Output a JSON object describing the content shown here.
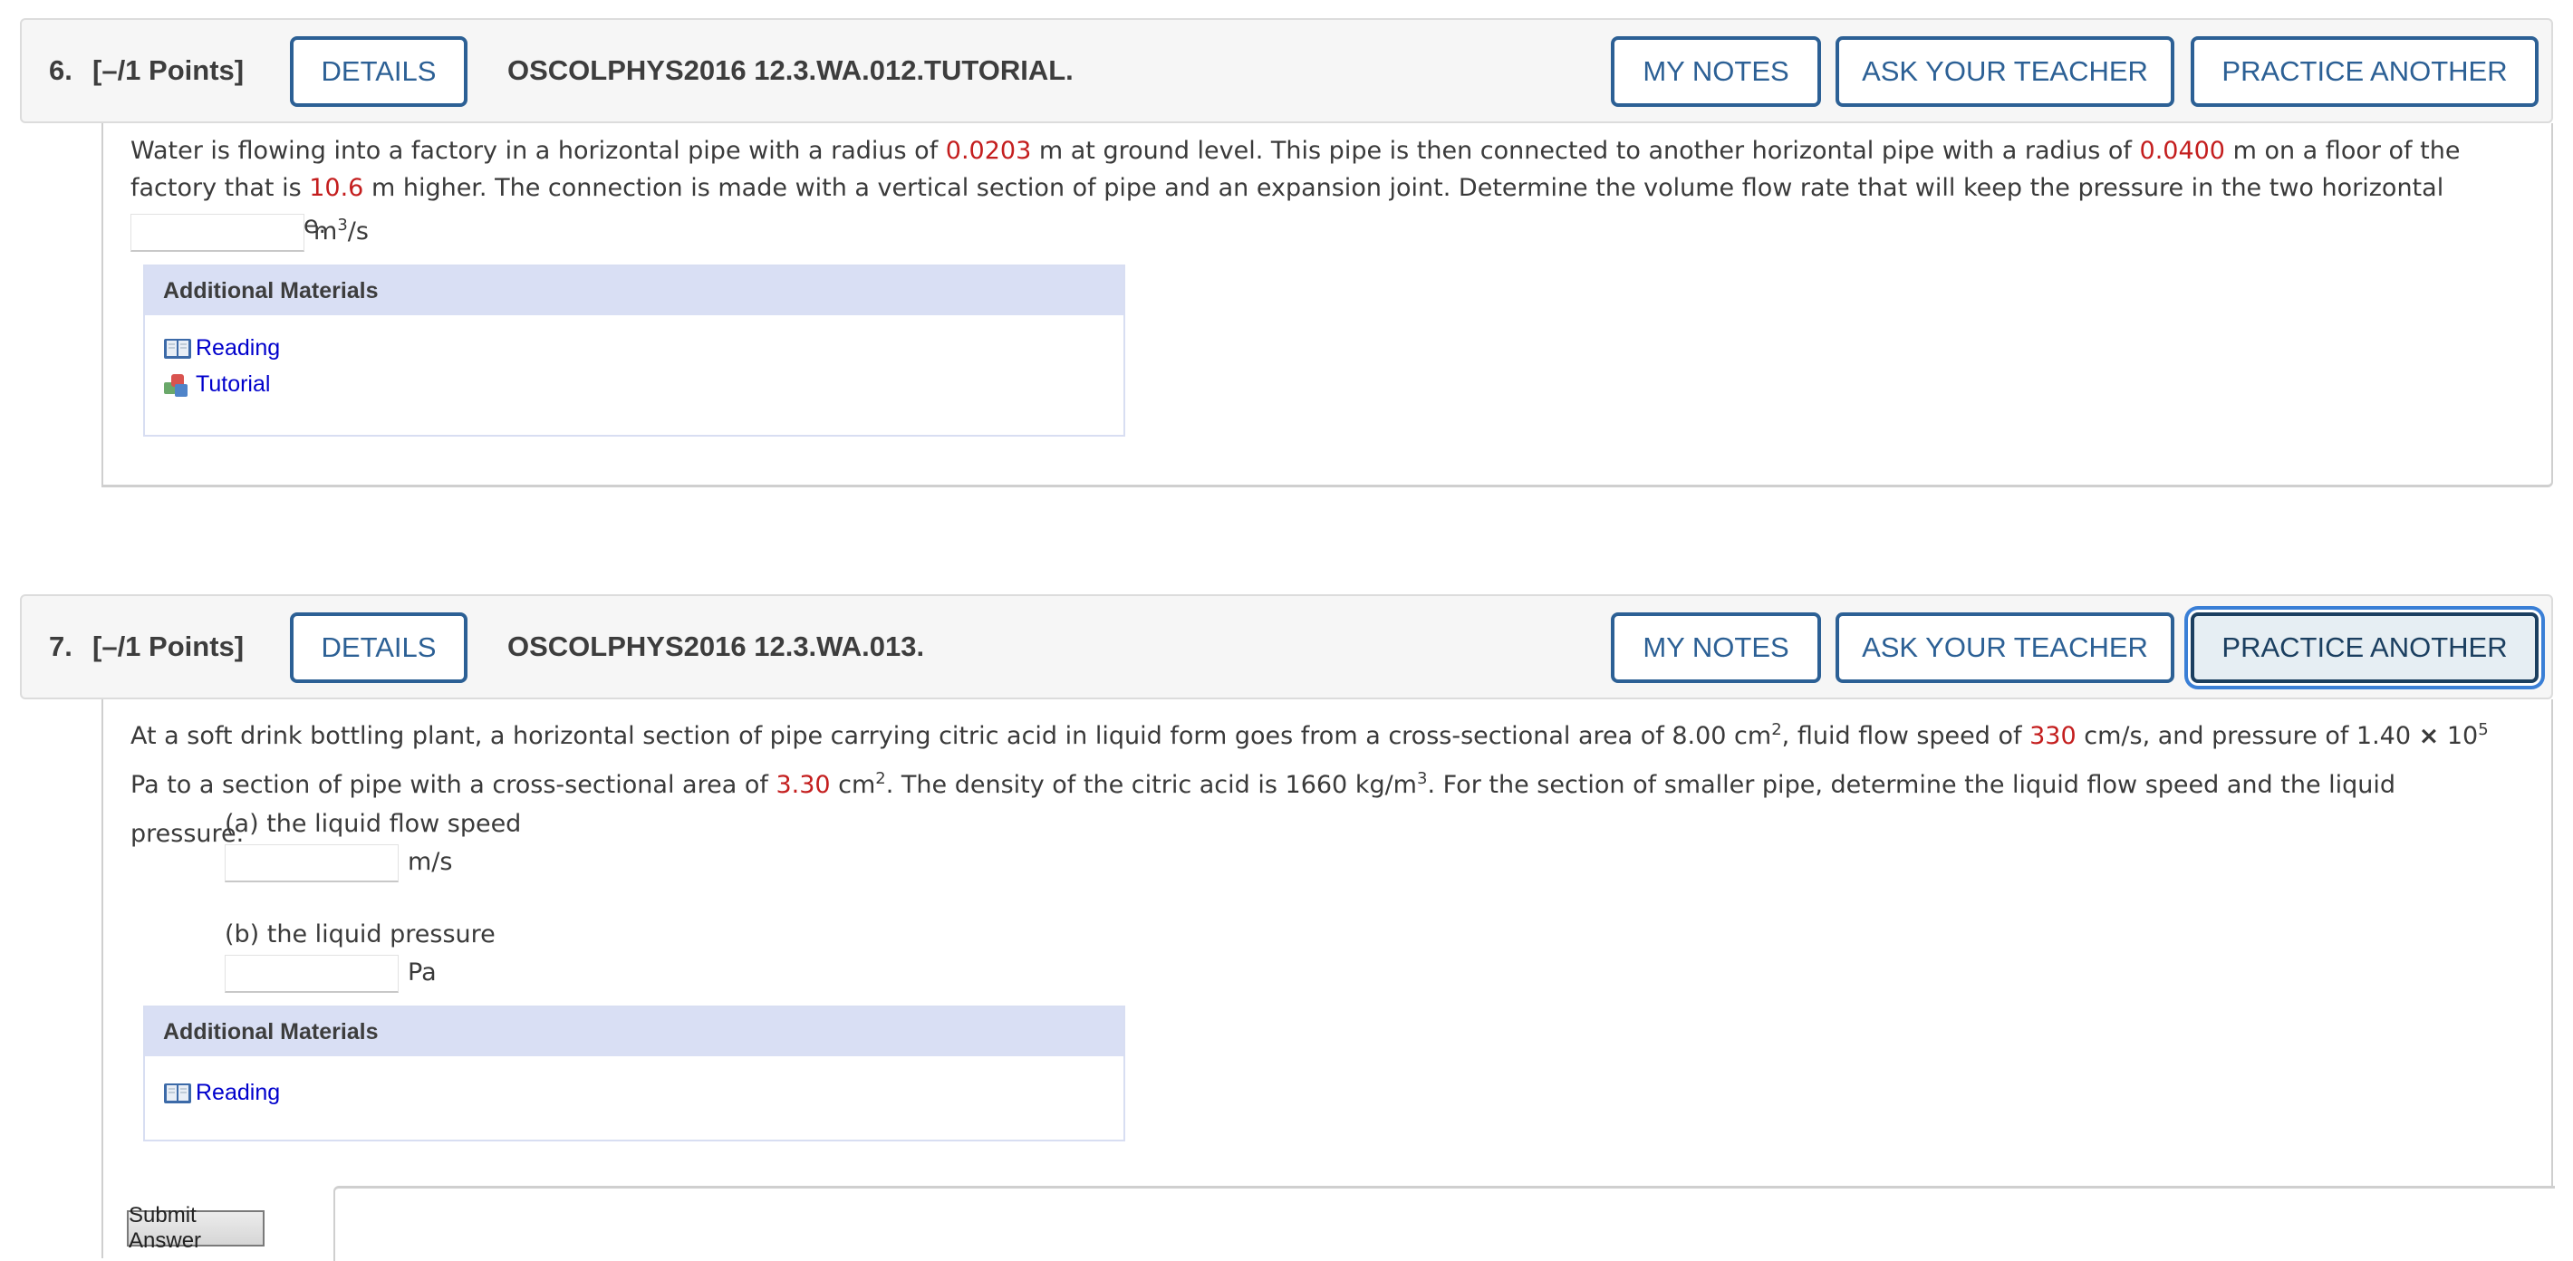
{
  "questions": [
    {
      "number": "6.",
      "points": "[–/1 Points]",
      "details_label": "DETAILS",
      "code": "OSCOLPHYS2016 12.3.WA.012.TUTORIAL.",
      "my_notes_label": "MY NOTES",
      "ask_teacher_label": "ASK YOUR TEACHER",
      "practice_label": "PRACTICE ANOTHER",
      "prompt": {
        "t1": "Water is flowing into a factory in a horizontal pipe with a radius of ",
        "v1": "0.0203",
        "t2": " m at ground level. This pipe is then connected to another horizontal pipe with a radius of ",
        "v2": "0.0400",
        "t3": " m on a floor of the factory that is ",
        "v3": "10.6",
        "t4": " m higher. The connection is made with a vertical section of pipe and an expansion joint. Determine the volume flow rate that will keep the pressure in the two horizontal pipes the same."
      },
      "answer": {
        "value": "",
        "unit_base": "m",
        "unit_sup": "3",
        "unit_tail": "/s"
      },
      "materials": {
        "heading": "Additional Materials",
        "links": [
          {
            "label": "Reading",
            "icon": "book-icon"
          },
          {
            "label": "Tutorial",
            "icon": "blocks-icon"
          }
        ]
      }
    },
    {
      "number": "7.",
      "points": "[–/1 Points]",
      "details_label": "DETAILS",
      "code": "OSCOLPHYS2016 12.3.WA.013.",
      "my_notes_label": "MY NOTES",
      "ask_teacher_label": "ASK YOUR TEACHER",
      "practice_label": "PRACTICE ANOTHER",
      "prompt": {
        "t1": "At a soft drink bottling plant, a horizontal section of pipe carrying citric acid in liquid form goes from a cross-sectional area of 8.00 cm",
        "s1": "2",
        "t2": ", fluid flow speed of ",
        "v1": "330",
        "t3": " cm/s, and pressure of 1.40 ",
        "times": "×",
        "t4": " 10",
        "s2": "5",
        "t5": " Pa to a section of pipe with a cross-sectional area of ",
        "v2": "3.30",
        "t6": " cm",
        "s3": "2",
        "t7": ". The density of the citric acid is 1660 kg/m",
        "s4": "3",
        "t8": ". For the section of smaller pipe, determine the liquid flow speed and the liquid pressure."
      },
      "parts": [
        {
          "label": "(a) the liquid flow speed",
          "value": "",
          "unit": "m/s"
        },
        {
          "label": "(b) the liquid pressure",
          "value": "",
          "unit": "Pa"
        }
      ],
      "materials": {
        "heading": "Additional Materials",
        "links": [
          {
            "label": "Reading",
            "icon": "book-icon"
          }
        ]
      }
    }
  ],
  "submit_label": "Submit Answer"
}
